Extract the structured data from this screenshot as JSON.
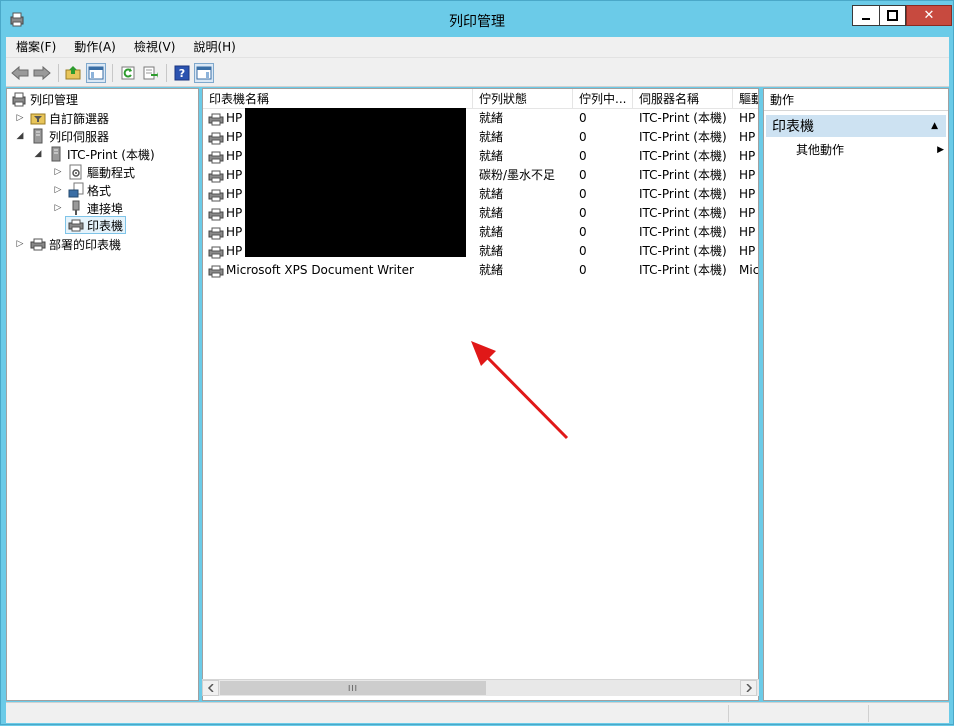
{
  "window": {
    "title": "列印管理",
    "close_glyph": "✕"
  },
  "menu": {
    "items": [
      "檔案(F)",
      "動作(A)",
      "檢視(V)",
      "說明(H)"
    ]
  },
  "toolbar": {
    "icons": [
      "back-icon",
      "forward-icon",
      "up-folder-icon",
      "show-hide-tree-icon",
      "refresh-icon",
      "export-list-icon",
      "help-icon",
      "action-pane-icon"
    ]
  },
  "tree": {
    "root": "列印管理",
    "nodes": [
      {
        "label": "自訂篩選器",
        "icon": "filter-folder-icon"
      },
      {
        "label": "列印伺服器",
        "icon": "server-icon"
      },
      {
        "label": "ITC-Print (本機)",
        "icon": "server-icon"
      },
      {
        "label": "驅動程式",
        "icon": "driver-icon"
      },
      {
        "label": "格式",
        "icon": "forms-icon"
      },
      {
        "label": "連接埠",
        "icon": "port-icon"
      },
      {
        "label": "印表機",
        "icon": "printer-icon"
      },
      {
        "label": "部署的印表機",
        "icon": "deployed-printer-icon"
      }
    ]
  },
  "list": {
    "columns": [
      "印表機名稱",
      "佇列狀態",
      "佇列中...",
      "伺服器名稱",
      "驅動"
    ],
    "rows": [
      {
        "name": "HP",
        "status": "就緒",
        "jobs": "0",
        "server": "ITC-Print (本機)",
        "driver": "HP"
      },
      {
        "name": "HP",
        "status": "就緒",
        "jobs": "0",
        "server": "ITC-Print (本機)",
        "driver": "HP"
      },
      {
        "name": "HP",
        "status": "就緒",
        "jobs": "0",
        "server": "ITC-Print (本機)",
        "driver": "HP"
      },
      {
        "name": "HP",
        "status": "碳粉/墨水不足",
        "jobs": "0",
        "server": "ITC-Print (本機)",
        "driver": "HP"
      },
      {
        "name": "HP",
        "status": "就緒",
        "jobs": "0",
        "server": "ITC-Print (本機)",
        "driver": "HP"
      },
      {
        "name": "HP",
        "status": "就緒",
        "jobs": "0",
        "server": "ITC-Print (本機)",
        "driver": "HP"
      },
      {
        "name": "HP",
        "status": "就緒",
        "jobs": "0",
        "server": "ITC-Print (本機)",
        "driver": "HP"
      },
      {
        "name": "HP",
        "status": "就緒",
        "jobs": "0",
        "server": "ITC-Print (本機)",
        "driver": "HP"
      },
      {
        "name": "Microsoft XPS Document Writer",
        "status": "就緒",
        "jobs": "0",
        "server": "ITC-Print (本機)",
        "driver": "Mic"
      }
    ],
    "scroll_thumb_glyph": "III"
  },
  "actions": {
    "header": "動作",
    "section": "印表機",
    "item": "其他動作"
  },
  "colors": {
    "titlebar": "#6bcbe8",
    "close_button": "#c74a3f",
    "selected_section": "#cde2f2",
    "annotation_arrow": "#e01818"
  }
}
